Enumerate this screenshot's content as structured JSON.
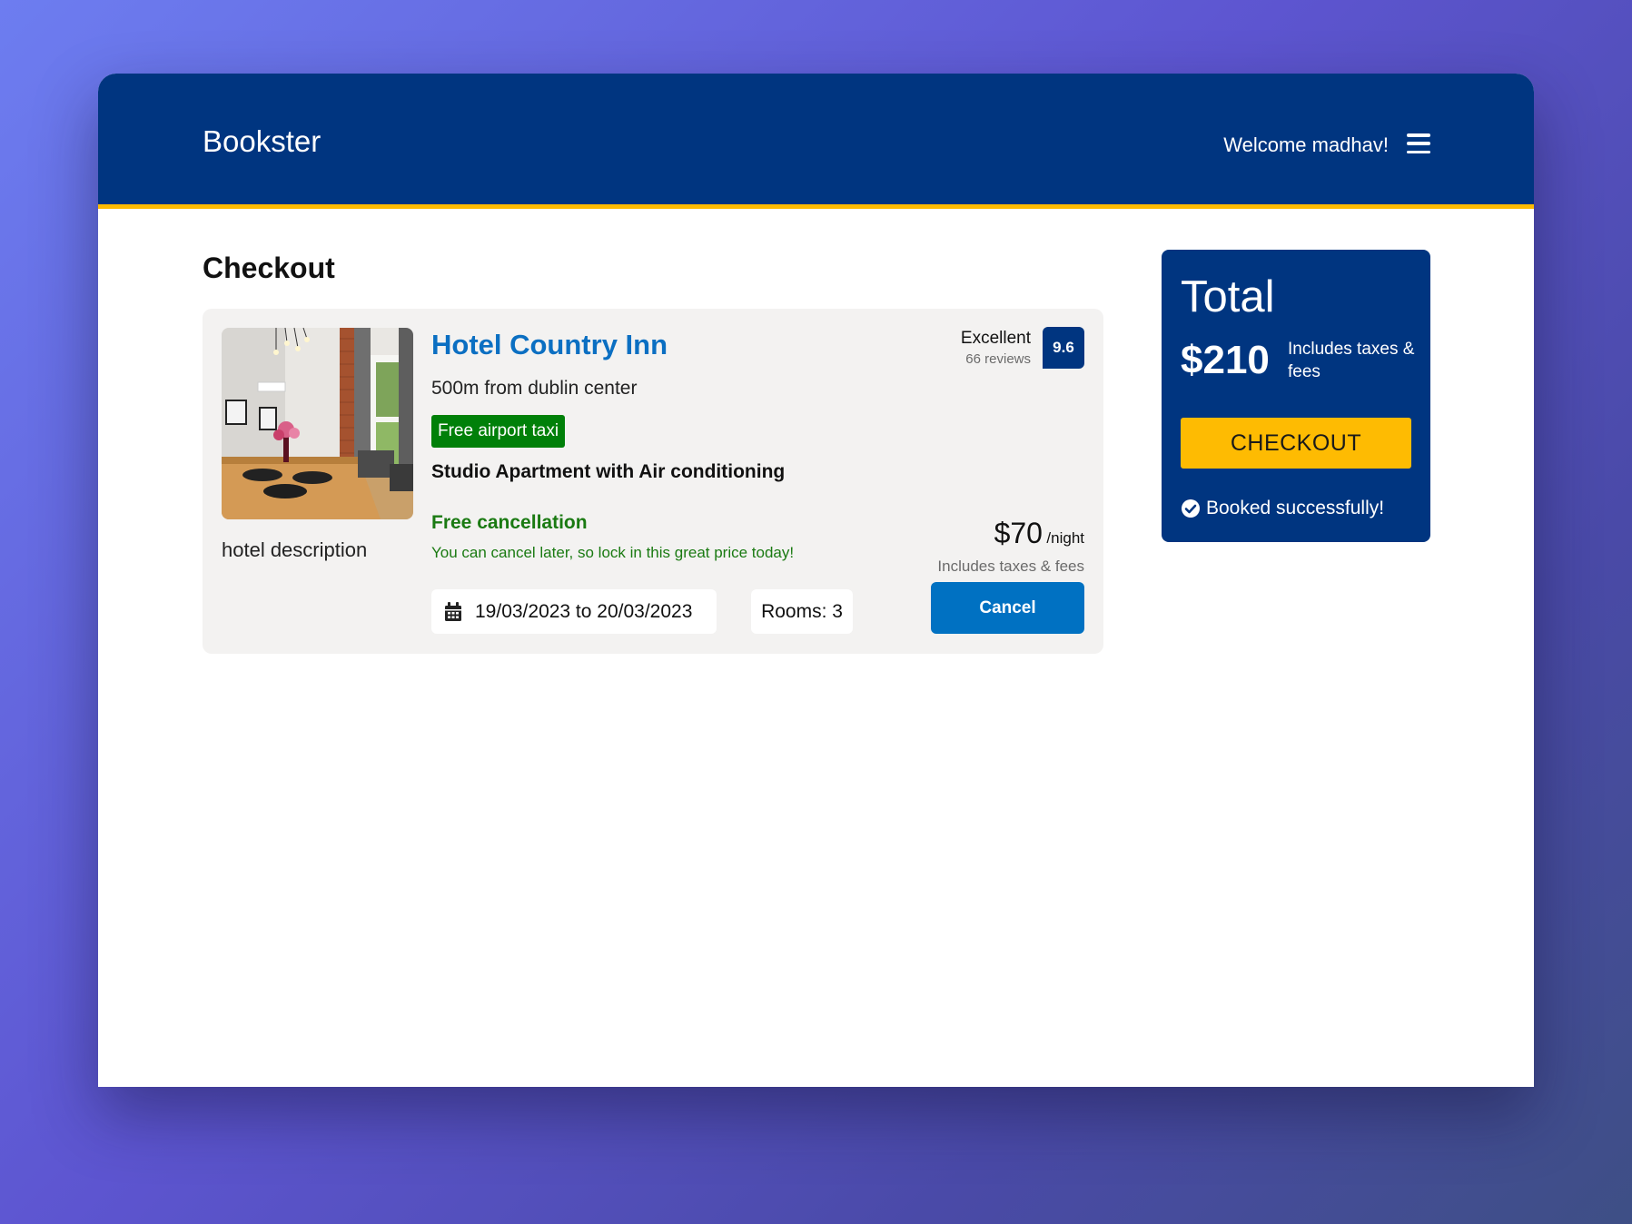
{
  "header": {
    "brand": "Bookster",
    "welcome": "Welcome madhav!",
    "menu_icon": "hamburger-menu-icon",
    "background": "#003580",
    "accent": "#febb02"
  },
  "page": {
    "title": "Checkout"
  },
  "booking": {
    "hotel_name": "Hotel Country Inn",
    "distance": "500m from dublin center",
    "taxi_badge": "Free airport taxi",
    "room_type": "Studio Apartment with Air conditioning",
    "free_cancellation": "Free cancellation",
    "cancel_note": "You can cancel later, so lock in this great price today!",
    "description": "hotel description",
    "rating_word": "Excellent",
    "reviews": "66 reviews",
    "score": "9.6",
    "price": "$70",
    "price_unit": "/night",
    "price_note": "Includes taxes & fees",
    "dates": "19/03/2023 to 20/03/2023",
    "date_icon": "calendar-icon",
    "rooms": "Rooms: 3",
    "cancel_button": "Cancel"
  },
  "summary": {
    "title": "Total",
    "amount": "$210",
    "note": "Includes taxes & fees",
    "checkout_button": "CHECKOUT",
    "status": "Booked successfully!",
    "status_icon": "check-circle-icon"
  }
}
